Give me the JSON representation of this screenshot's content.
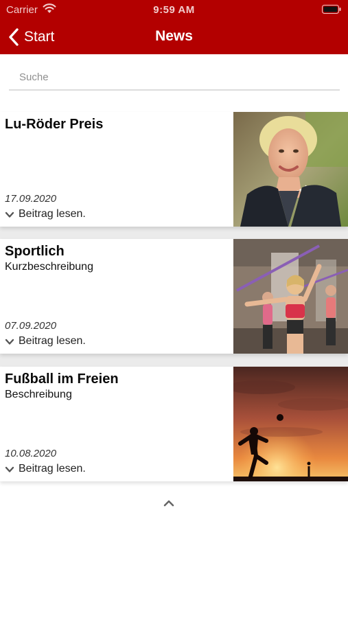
{
  "status_bar": {
    "carrier": "Carrier",
    "time": "9:59 AM"
  },
  "nav": {
    "back_label": "Start",
    "title": "News"
  },
  "search": {
    "placeholder": "Suche",
    "value": ""
  },
  "articles": [
    {
      "title": "Lu-Röder Preis",
      "description": "",
      "date": "17.09.2020",
      "read_more": "Beitrag lesen.",
      "image": "portrait-woman"
    },
    {
      "title": "Sportlich",
      "description": "Kurzbeschreibung",
      "date": "07.09.2020",
      "read_more": "Beitrag lesen.",
      "image": "fitness-class"
    },
    {
      "title": "Fußball im Freien",
      "description": "Beschreibung",
      "date": "10.08.2020",
      "read_more": "Beitrag lesen.",
      "image": "soccer-sunset"
    }
  ],
  "icons": {
    "back": "chevron-left-icon",
    "read_more": "chevron-down-icon",
    "scroll_top": "chevron-up-icon",
    "wifi": "wifi-icon",
    "battery": "battery-icon"
  },
  "colors": {
    "accent": "#b30000",
    "separator": "#ebebeb",
    "background": "#ffffff"
  }
}
